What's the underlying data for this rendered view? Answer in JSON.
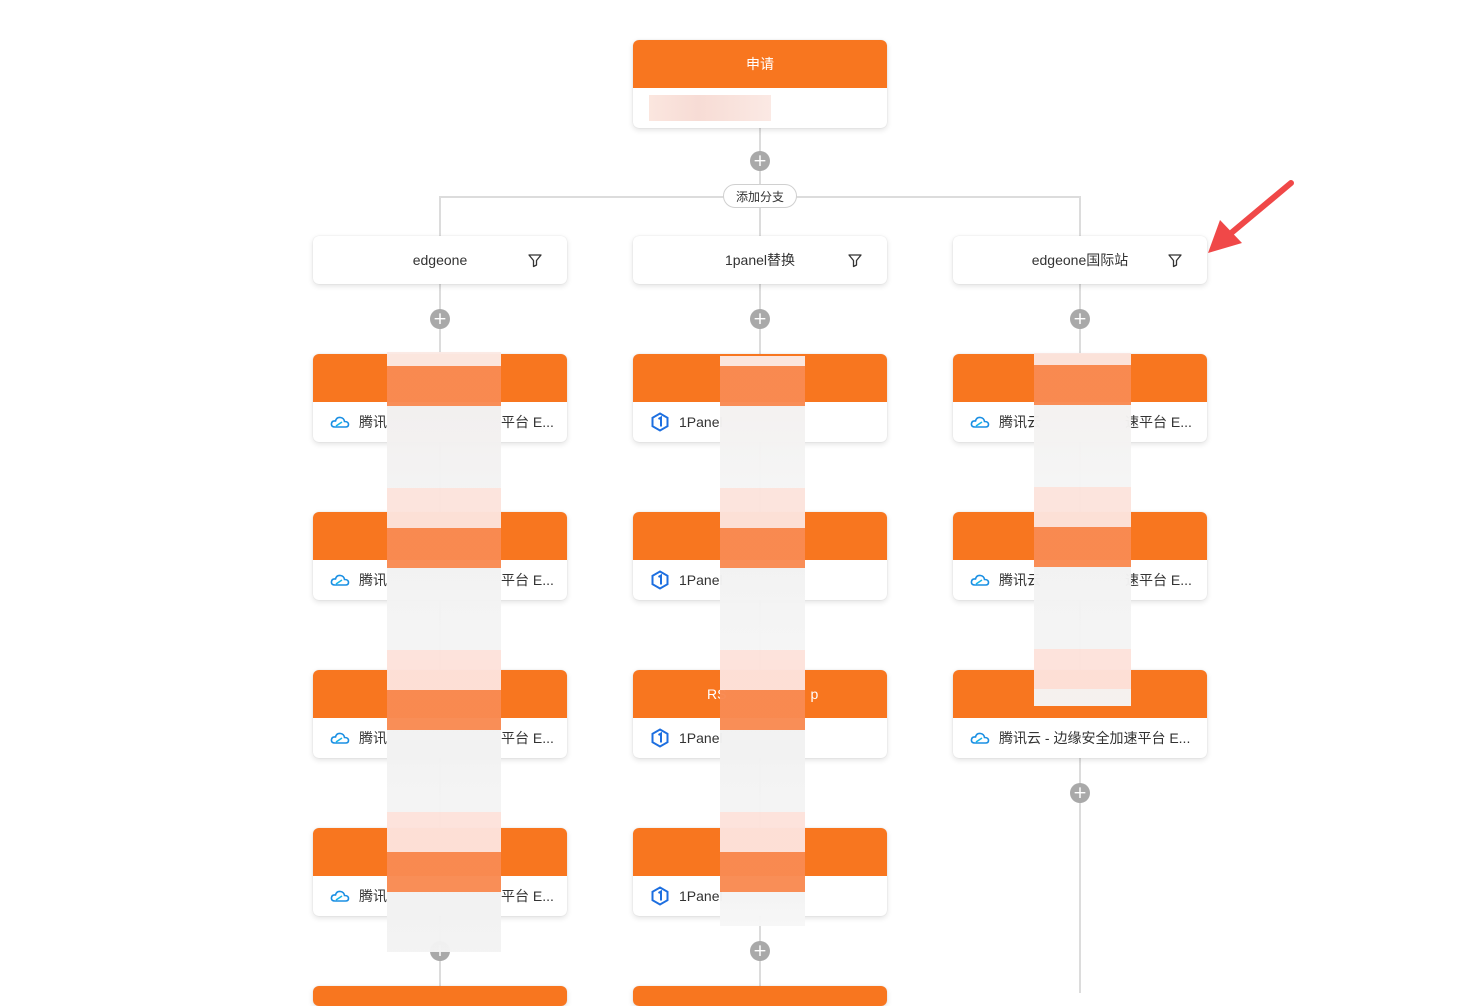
{
  "start_node": {
    "title": "申请"
  },
  "add_branch_label": "添加分支",
  "plus_symbol": "+",
  "accent_color": "#f8761f",
  "branches": [
    {
      "label": "edgeone"
    },
    {
      "label": "1panel替换"
    },
    {
      "label": "edgeone国际站"
    }
  ],
  "nodes": {
    "col1": [
      {
        "title": "",
        "provider": "腾讯",
        "suffix": "平台 E..."
      },
      {
        "title": "",
        "provider": "腾讯",
        "suffix": "平台 E..."
      },
      {
        "title": "",
        "provider": "腾讯",
        "suffix": "平台 E..."
      },
      {
        "title": "",
        "provider": "腾讯",
        "suffix": "平台 E..."
      }
    ],
    "col2": [
      {
        "title": "",
        "provider": "1Panel"
      },
      {
        "title": "",
        "provider": "1Panel"
      },
      {
        "title_left": "RS",
        "title_right": "p",
        "provider": "1Panel"
      },
      {
        "title": "",
        "provider": "1Panel"
      }
    ],
    "col3": [
      {
        "title": "",
        "provider": "腾讯云",
        "suffix": "速平台 E..."
      },
      {
        "title": "",
        "provider": "腾讯云",
        "suffix": "速平台 E..."
      },
      {
        "title": "",
        "provider": "腾讯云 - 边缘安全加速平台 E..."
      }
    ]
  },
  "icons": {
    "cloud": "tencent-cloud-icon",
    "panel": "1panel-icon",
    "filter": "filter-icon",
    "arrow": "red-arrow-annotation"
  }
}
